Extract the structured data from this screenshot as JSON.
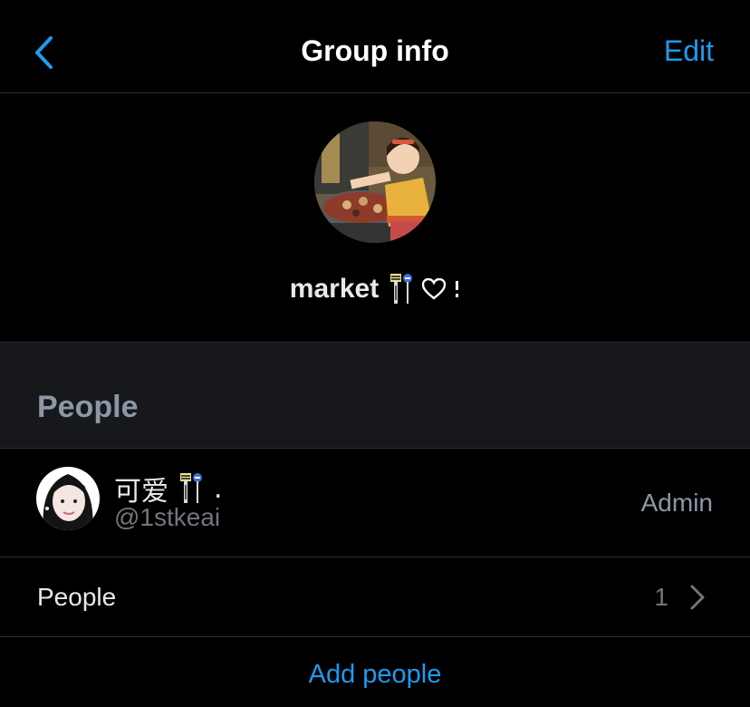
{
  "header": {
    "title": "Group info",
    "edit_label": "Edit",
    "back_icon": "chevron-left-icon"
  },
  "group": {
    "name": "market",
    "name_emojis": [
      "bus-stop-icon",
      "white-heart-icon",
      "sparkle-icon"
    ],
    "heart": "♡",
    "avatar": "group-avatar-image"
  },
  "section": {
    "title": "People"
  },
  "members": [
    {
      "name": "可爱",
      "suffix": ".",
      "handle": "@1stkeai",
      "role": "Admin",
      "avatar": "member-avatar-image"
    }
  ],
  "people_row": {
    "label": "People",
    "count": "1"
  },
  "add_people_label": "Add people",
  "colors": {
    "accent": "#1d9bf0",
    "background": "#000000",
    "section_bg": "#16181c",
    "divider": "#2b2f33",
    "secondary_text": "#71767b"
  }
}
